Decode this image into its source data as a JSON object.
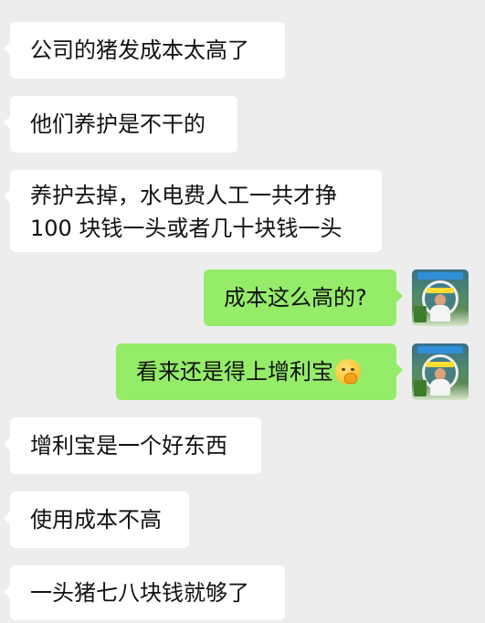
{
  "messages": [
    {
      "side": "in",
      "lines": [
        "公司的猪发成本太高了"
      ]
    },
    {
      "side": "in",
      "lines": [
        "他们养护是不干的"
      ]
    },
    {
      "side": "in",
      "lines": [
        "养护去掉，水电费人工一共才挣",
        "100 块钱一头或者几十块钱一头"
      ]
    },
    {
      "side": "out",
      "lines": [
        "成本这么高的?"
      ]
    },
    {
      "side": "out",
      "lines": [
        "看来还是得上增利宝"
      ],
      "emoji": "thinking-face-emoji"
    },
    {
      "side": "in",
      "lines": [
        "增利宝是一个好东西"
      ]
    },
    {
      "side": "in",
      "lines": [
        "使用成本不高"
      ]
    },
    {
      "side": "in",
      "lines": [
        "一头猪七八块钱就够了"
      ]
    }
  ],
  "colors": {
    "background": "#ededed",
    "incoming_bubble": "#ffffff",
    "outgoing_bubble": "#95ec69",
    "text": "#111111"
  }
}
